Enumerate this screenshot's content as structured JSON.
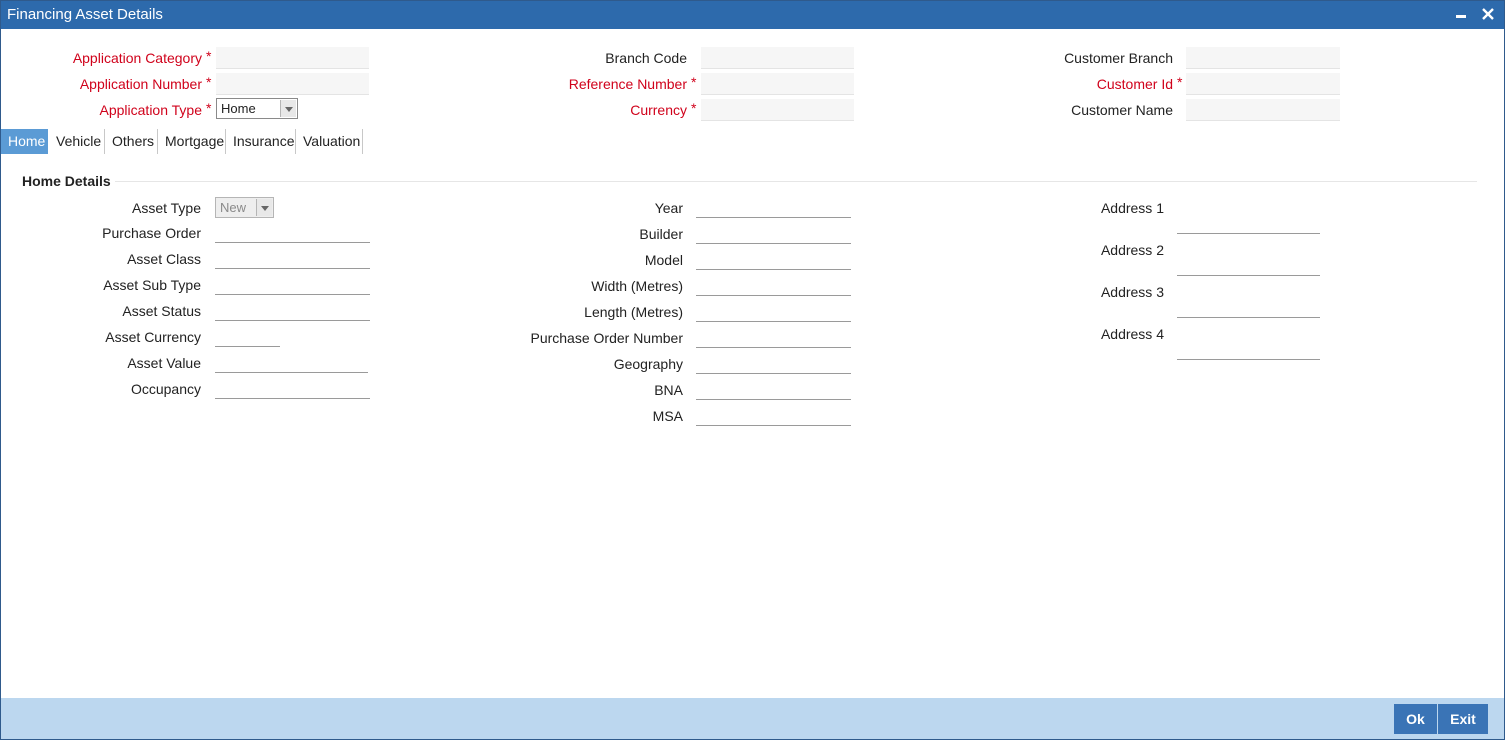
{
  "window": {
    "title": "Financing Asset Details"
  },
  "header": {
    "application_category": {
      "label": "Application Category",
      "value": ""
    },
    "application_number": {
      "label": "Application Number",
      "value": ""
    },
    "application_type": {
      "label": "Application Type",
      "value": "Home"
    },
    "branch_code": {
      "label": "Branch Code",
      "value": ""
    },
    "reference_number": {
      "label": "Reference Number",
      "value": ""
    },
    "currency": {
      "label": "Currency",
      "value": ""
    },
    "customer_branch": {
      "label": "Customer Branch",
      "value": ""
    },
    "customer_id": {
      "label": "Customer Id",
      "value": ""
    },
    "customer_name": {
      "label": "Customer Name",
      "value": ""
    },
    "required_mark": "*"
  },
  "tabs": [
    {
      "label": "Home",
      "active": true
    },
    {
      "label": "Vehicle",
      "active": false
    },
    {
      "label": "Others",
      "active": false
    },
    {
      "label": "Mortgage",
      "active": false
    },
    {
      "label": "Insurance",
      "active": false
    },
    {
      "label": "Valuation",
      "active": false
    }
  ],
  "home_details": {
    "title": "Home Details",
    "asset_type": {
      "label": "Asset Type",
      "value": "New"
    },
    "purchase_order": {
      "label": "Purchase Order",
      "value": ""
    },
    "asset_class": {
      "label": "Asset Class",
      "value": ""
    },
    "asset_sub_type": {
      "label": "Asset Sub Type",
      "value": ""
    },
    "asset_status": {
      "label": "Asset Status",
      "value": ""
    },
    "asset_currency": {
      "label": "Asset Currency",
      "value": ""
    },
    "asset_value": {
      "label": "Asset Value",
      "value": ""
    },
    "occupancy": {
      "label": "Occupancy",
      "value": ""
    },
    "year": {
      "label": "Year",
      "value": ""
    },
    "builder": {
      "label": "Builder",
      "value": ""
    },
    "model": {
      "label": "Model",
      "value": ""
    },
    "width": {
      "label": "Width (Metres)",
      "value": ""
    },
    "length": {
      "label": "Length (Metres)",
      "value": ""
    },
    "purchase_order_number": {
      "label": "Purchase Order Number",
      "value": ""
    },
    "geography": {
      "label": "Geography",
      "value": ""
    },
    "bna": {
      "label": "BNA",
      "value": ""
    },
    "msa": {
      "label": "MSA",
      "value": ""
    },
    "address1": {
      "label": "Address 1",
      "value": ""
    },
    "address2": {
      "label": "Address 2",
      "value": ""
    },
    "address3": {
      "label": "Address 3",
      "value": ""
    },
    "address4": {
      "label": "Address 4",
      "value": ""
    }
  },
  "footer": {
    "ok_label": "Ok",
    "exit_label": "Exit"
  },
  "colors": {
    "titlebar": "#2d6aac",
    "required": "#d0021b",
    "active_tab": "#5b9bd5",
    "footer": "#bcd7ef",
    "button": "#3a74b6"
  }
}
